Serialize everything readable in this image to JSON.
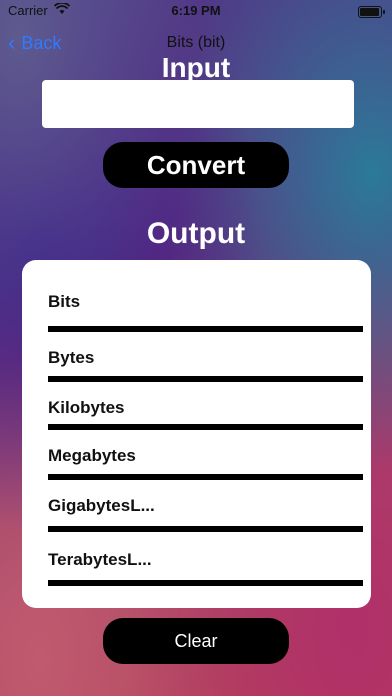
{
  "status": {
    "carrier": "Carrier",
    "time": "6:19 PM"
  },
  "nav": {
    "back_label": "Back",
    "title": "Bits (bit)"
  },
  "input": {
    "header": "Input",
    "value": ""
  },
  "buttons": {
    "convert_label": "Convert",
    "clear_label": "Clear"
  },
  "output": {
    "title": "Output",
    "rows": [
      "Bits",
      "Bytes",
      "Kilobytes",
      "Megabytes",
      "GigabytesL...",
      "TerabytesL..."
    ]
  }
}
